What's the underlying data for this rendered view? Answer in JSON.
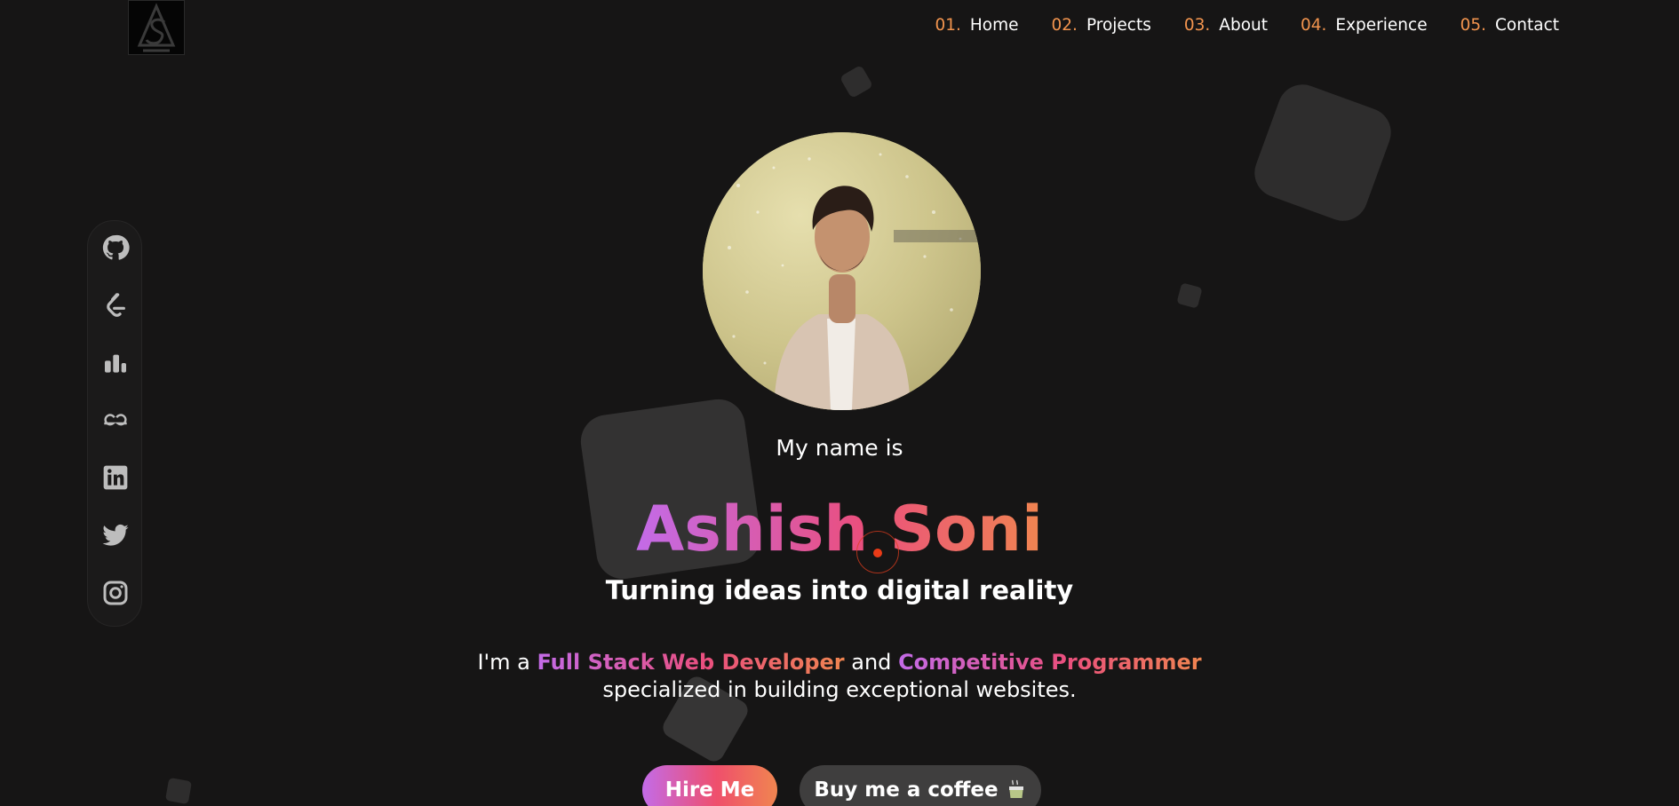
{
  "nav": {
    "items": [
      {
        "num": "01.",
        "label": "Home"
      },
      {
        "num": "02.",
        "label": "Projects"
      },
      {
        "num": "03.",
        "label": "About"
      },
      {
        "num": "04.",
        "label": "Experience"
      },
      {
        "num": "05.",
        "label": "Contact"
      }
    ]
  },
  "social": [
    "github-icon",
    "leetcode-icon",
    "codechef-icon",
    "geeksforgeeks-icon",
    "linkedin-icon",
    "twitter-icon",
    "instagram-icon"
  ],
  "hero": {
    "intro": "My name is",
    "name": "Ashish Soni",
    "tagline": "Turning ideas into digital reality",
    "desc_prefix": "I'm a",
    "role1": "Full Stack Web Developer",
    "desc_and": "and",
    "role2": "Competitive Programmer",
    "desc_suffix": "specialized in building exceptional websites."
  },
  "buttons": {
    "hire": "Hire Me",
    "coffee": "Buy me a coffee"
  },
  "colors": {
    "background": "#161515",
    "accent_orange": "#f2944e",
    "gradient_start": "#c36be8",
    "gradient_mid": "#ea4f7e",
    "gradient_end": "#f08550"
  }
}
